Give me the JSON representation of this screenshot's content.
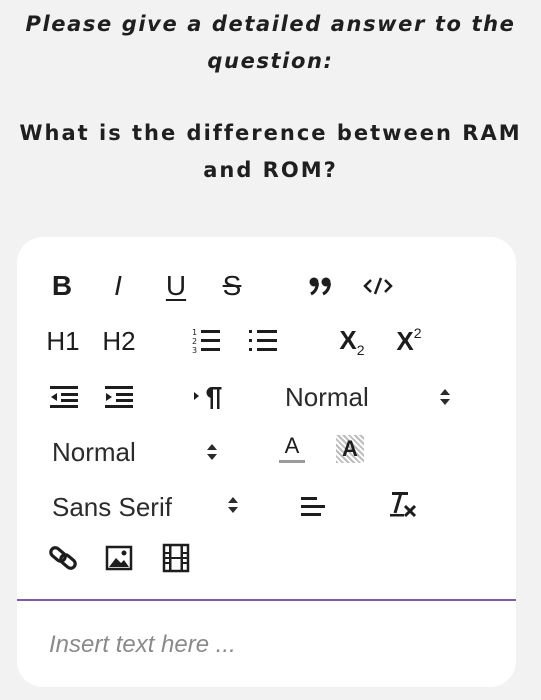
{
  "prompt": {
    "instruction_line1": "Please give a detailed answer to the",
    "instruction_line2": "question:",
    "question_line1": "What is the difference between RAM",
    "question_line2": "and ROM?"
  },
  "toolbar": {
    "bold_label": "B",
    "italic_label": "I",
    "underline_label": "U",
    "strike_label": "S",
    "h1_label": "H1",
    "h2_label": "H2",
    "subscript_label": "X",
    "superscript_label": "X",
    "color_label": "A",
    "background_label": "A",
    "header_select_value": "Normal",
    "size_select_value": "Normal",
    "font_select_value": "Sans Serif",
    "icons": [
      "bold",
      "italic",
      "underline",
      "strike",
      "blockquote-icon",
      "code-block-icon",
      "header-1",
      "header-2",
      "ordered-list-icon",
      "bullet-list-icon",
      "subscript-icon",
      "superscript-icon",
      "outdent-icon",
      "indent-icon",
      "rtl-direction-icon",
      "header-select",
      "size-select",
      "text-color-icon",
      "background-color-icon",
      "font-select",
      "align-icon",
      "clear-format-icon",
      "link-icon",
      "image-icon",
      "video-icon"
    ]
  },
  "editor": {
    "placeholder": "Insert text here ..."
  },
  "colors": {
    "page_background": "#f2f2f2",
    "editor_background": "#ffffff",
    "divider": "#7b5aa6",
    "placeholder_text": "#8a8a8a"
  }
}
